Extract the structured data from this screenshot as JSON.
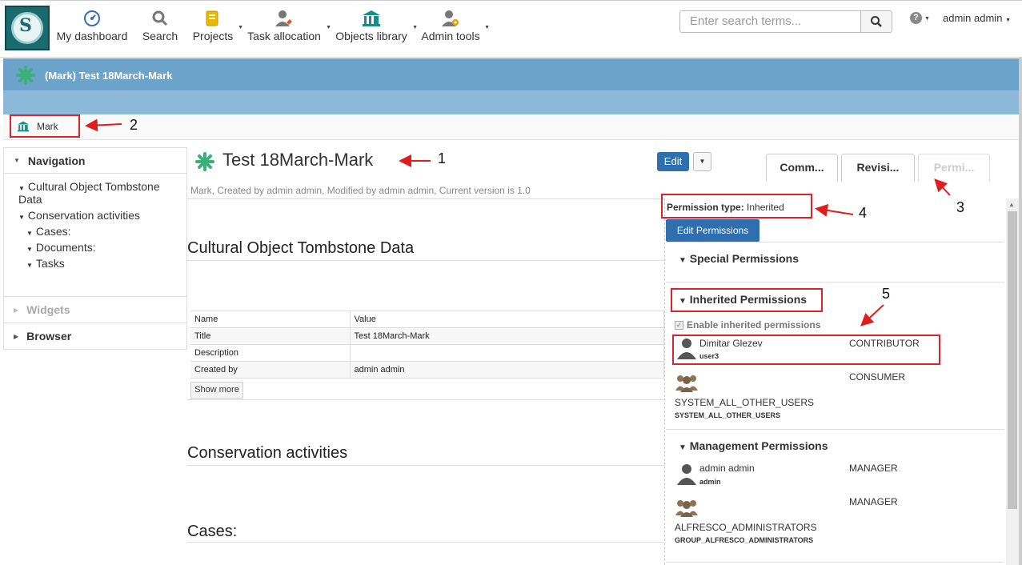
{
  "nav": {
    "items": [
      {
        "label": "My dashboard",
        "icon": "dashboard-gauge-icon"
      },
      {
        "label": "Search",
        "icon": "magnifier-icon"
      },
      {
        "label": "Projects",
        "icon": "folder-icon"
      },
      {
        "label": "Task allocation",
        "icon": "user-task-icon"
      },
      {
        "label": "Objects library",
        "icon": "museum-icon"
      },
      {
        "label": "Admin tools",
        "icon": "user-gear-icon"
      }
    ],
    "search_placeholder": "Enter search terms...",
    "user": "admin admin"
  },
  "banner": {
    "title": "(Mark) Test 18March-Mark"
  },
  "breadcrumb": {
    "label": "Mark"
  },
  "sidebar": {
    "navigation": "Navigation",
    "tree": {
      "item1": "Cultural Object Tombstone Data",
      "item2": "Conservation activities",
      "sub1": "Cases:",
      "sub2": "Documents:",
      "sub3": "Tasks"
    },
    "widgets": "Widgets",
    "browser": "Browser"
  },
  "main": {
    "title": "Test 18March-Mark",
    "meta": "Mark, Created by admin admin, Modified by admin admin, Current version is 1.0",
    "edit": "Edit",
    "tabs": [
      "Comm...",
      "Revisi...",
      "Permi..."
    ],
    "sections": {
      "tombstone": "Cultural Object Tombstone Data",
      "conservation": "Conservation activities",
      "cases": "Cases:"
    },
    "table": {
      "headers": [
        "Name",
        "Value"
      ],
      "rows": [
        [
          "Title",
          "Test 18March-Mark"
        ],
        [
          "Description",
          ""
        ],
        [
          "Created by",
          "admin admin"
        ]
      ]
    },
    "show_more": "Show more"
  },
  "permissions": {
    "type_label": "Permission type:",
    "type_value": "Inherited",
    "edit_button": "Edit Permissions",
    "special": "Special Permissions",
    "inherited": "Inherited Permissions",
    "enable_inherited": "Enable inherited permissions",
    "management": "Management Permissions",
    "inherited_rows": [
      {
        "name": "Dimitar Glezev",
        "sub": "user3",
        "role": "CONTRIBUTOR"
      },
      {
        "name": "SYSTEM_ALL_OTHER_USERS",
        "sub": "SYSTEM_ALL_OTHER_USERS",
        "role": "CONSUMER"
      }
    ],
    "management_rows": [
      {
        "name": "admin admin",
        "sub": "admin",
        "role": "MANAGER"
      },
      {
        "name": "ALFRESCO_ADMINISTRATORS",
        "sub": "GROUP_ALFRESCO_ADMINISTRATORS",
        "role": "MANAGER"
      }
    ]
  },
  "annotations": [
    "1",
    "2",
    "3",
    "4",
    "5"
  ]
}
